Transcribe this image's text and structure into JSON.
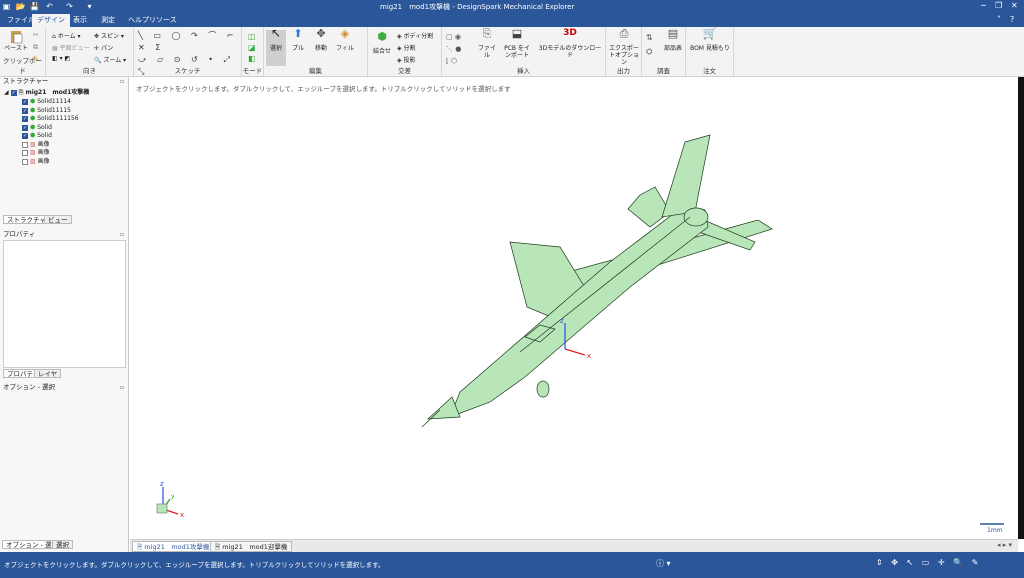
{
  "titlebar": {
    "title": "mig21　mod1攻撃機 - DesignSpark Mechanical Explorer"
  },
  "tabs": [
    {
      "label": "ファイル"
    },
    {
      "label": "デザイン"
    },
    {
      "label": "表示"
    },
    {
      "label": "測定"
    },
    {
      "label": "ヘルプリソース"
    }
  ],
  "ribbon": {
    "clipboard": {
      "label": "クリップボード",
      "paste": "ペースト"
    },
    "orient": {
      "label": "向き",
      "home": "ホーム",
      "plane_view": "平面ビュー",
      "spin": "スピン",
      "pan": "パン",
      "zoom": "ズーム"
    },
    "sketch": {
      "label": "スケッチ"
    },
    "mode": {
      "label": "モード"
    },
    "edit": {
      "label": "編集",
      "select": "選択",
      "pull": "プル",
      "move": "移動",
      "fill": "フィル"
    },
    "intersect": {
      "label": "交差",
      "combine": "結合せ",
      "split_body": "ボディ分割",
      "split": "分割",
      "project": "投影"
    },
    "insert": {
      "label": "挿入",
      "file": "ファイル",
      "pcb": "PCB をインポート",
      "download3d": "3Dモデルのダウンロード",
      "logo3d": "3D"
    },
    "output": {
      "label": "出力",
      "export_options": "エクスポートオプション"
    },
    "investigate": {
      "label": "調査",
      "parts_table": "部品表"
    },
    "order": {
      "label": "注文",
      "bom": "BOM 見積もり"
    }
  },
  "structure": {
    "header": "ストラクチャー",
    "root": "mig21　mod1攻撃機",
    "items": [
      {
        "label": "Solid11114",
        "checked": true,
        "kind": "solid"
      },
      {
        "label": "Solid11115",
        "checked": true,
        "kind": "solid"
      },
      {
        "label": "Solid1111156",
        "checked": true,
        "kind": "solid"
      },
      {
        "label": "Solid",
        "checked": true,
        "kind": "solid"
      },
      {
        "label": "Solid",
        "checked": true,
        "kind": "solid"
      },
      {
        "label": "画像",
        "checked": false,
        "kind": "image"
      },
      {
        "label": "画像",
        "checked": false,
        "kind": "image"
      },
      {
        "label": "画像",
        "checked": false,
        "kind": "image"
      }
    ],
    "tab_structure": "ストラクチャー",
    "tab_view": "ビュー"
  },
  "properties": {
    "header": "プロパティ",
    "tab_properties": "プロパティ",
    "tab_layers": "レイヤ"
  },
  "options": {
    "header": "オプション - 選択",
    "tab_options": "オプション - 選択",
    "tab_select": "選択"
  },
  "viewport": {
    "hint": "オブジェクトをクリックします。ダブルクリックして、エッジループを選択します。トリプルクリックしてソリッドを選択します",
    "scale_label": "1mm",
    "model_color": "#b9e6b9",
    "axis_x": "x",
    "axis_y": "y",
    "axis_z": "z"
  },
  "doc_tabs": [
    {
      "label": "mig21　mod1攻撃機",
      "active": true
    },
    {
      "label": "mig21　mod1迎撃機",
      "active": false
    }
  ],
  "statusbar": {
    "text": "オブジェクトをクリックします。ダブルクリックして、エッジループを選択します。トリプルクリックしてソリッドを選択します。"
  },
  "colors": {
    "accent": "#2b579a",
    "axis_x": "#e02020",
    "axis_y": "#20a020",
    "axis_z": "#2050e0"
  }
}
